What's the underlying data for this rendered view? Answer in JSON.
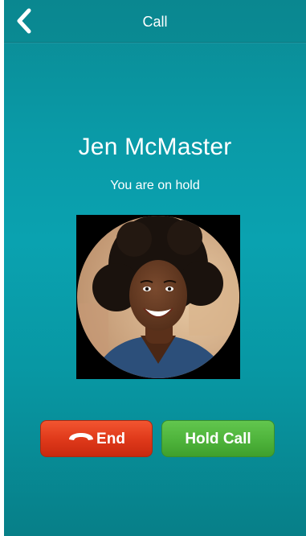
{
  "navbar": {
    "title": "Call",
    "back_icon": "chevron-left-icon"
  },
  "call": {
    "caller_name": "Jen McMaster",
    "status": "You are on hold"
  },
  "actions": {
    "end_label": "End",
    "end_icon": "phone-hangup-icon",
    "hold_label": "Hold Call"
  },
  "colors": {
    "background": "#0a9aa7",
    "end_button": "#e03a1b",
    "hold_button": "#4eb33b"
  }
}
